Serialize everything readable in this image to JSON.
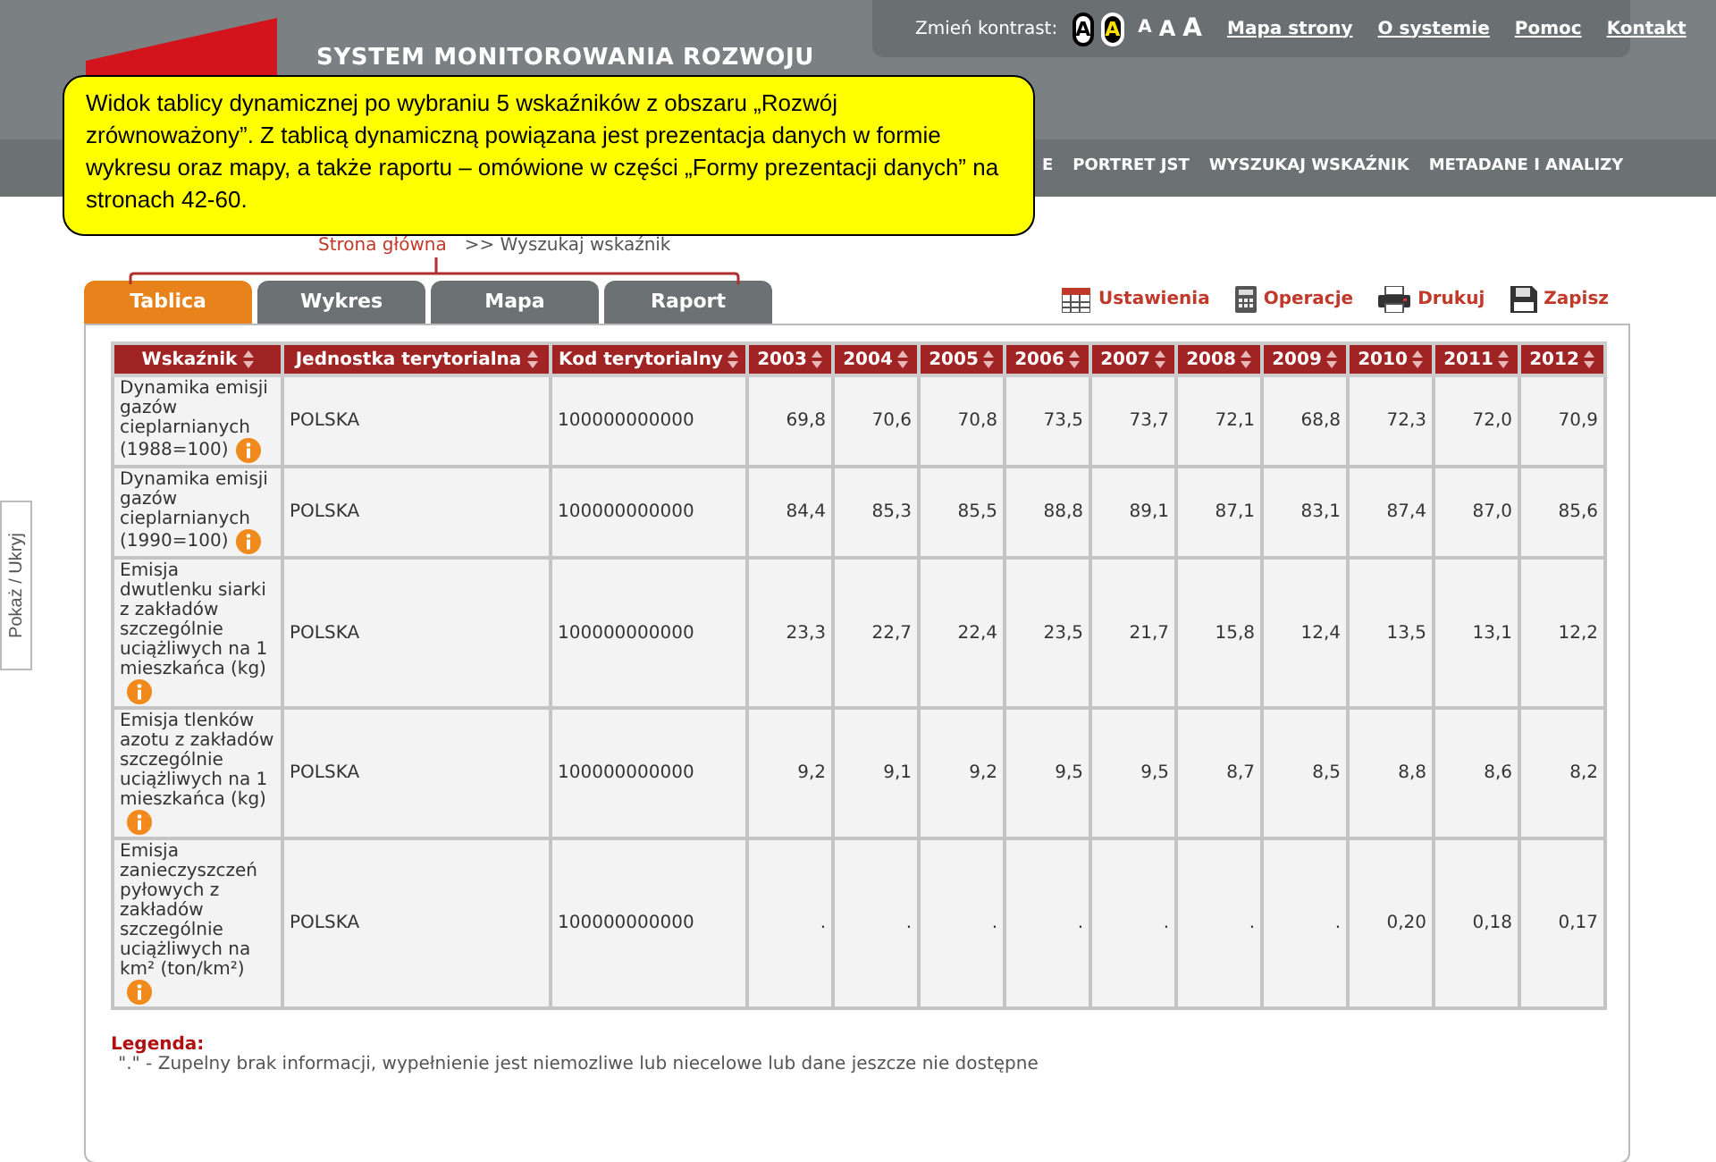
{
  "header": {
    "title": "SYSTEM MONITOROWANIA ROZWOJU",
    "contrast_label": "Zmień kontrast:",
    "contrast_buttons": [
      {
        "label": "A",
        "kind": "normal"
      },
      {
        "label": "A",
        "kind": "high"
      }
    ],
    "font_sizes": [
      "A",
      "A",
      "A"
    ],
    "links": [
      "Mapa strony",
      "O systemie",
      "Pomoc",
      "Kontakt"
    ]
  },
  "nav": {
    "items": [
      "E",
      "PORTRET JST",
      "WYSZUKAJ WSKAŹNIK",
      "METADANE I ANALIZY"
    ]
  },
  "breadcrumb": [
    "Strona główna",
    ">> Wyszukaj wskaźnik"
  ],
  "callout": "Widok tablicy dynamicznej po wybraniu 5 wskaźników z obszaru „Rozwój zrównoważony”.  Z tablicą dynamiczną powiązana jest prezentacja danych w formie wykresu oraz mapy, a także raportu – omówione w części  „Formy prezentacji danych” na stronach 42-60.",
  "side_toggle": "Pokaż / Ukryj",
  "tabs": [
    {
      "label": "Tablica",
      "selected": true
    },
    {
      "label": "Wykres",
      "selected": false
    },
    {
      "label": "Mapa",
      "selected": false
    },
    {
      "label": "Raport",
      "selected": false
    }
  ],
  "actions": [
    {
      "label": "Ustawienia",
      "kind": "settings"
    },
    {
      "label": "Operacje",
      "kind": "calculator"
    },
    {
      "label": "Drukuj",
      "kind": "print"
    },
    {
      "label": "Zapisz",
      "kind": "save"
    }
  ],
  "table": {
    "columns": [
      "Wskaźnik",
      "Jednostka terytorialna",
      "Kod terytorialny",
      "2003",
      "2004",
      "2005",
      "2006",
      "2007",
      "2008",
      "2009",
      "2010",
      "2011",
      "2012"
    ],
    "rows": [
      {
        "indicator": "Dynamika emisji gazów cieplarnianych (1988=100)",
        "unit": "POLSKA",
        "code": "100000000000",
        "values": [
          "69,8",
          "70,6",
          "70,8",
          "73,5",
          "73,7",
          "72,1",
          "68,8",
          "72,3",
          "72,0",
          "70,9"
        ]
      },
      {
        "indicator": "Dynamika emisji gazów cieplarnianych (1990=100)",
        "unit": "POLSKA",
        "code": "100000000000",
        "values": [
          "84,4",
          "85,3",
          "85,5",
          "88,8",
          "89,1",
          "87,1",
          "83,1",
          "87,4",
          "87,0",
          "85,6"
        ]
      },
      {
        "indicator": "Emisja dwutlenku siarki z zakładów szczególnie uciążliwych na 1 mieszkańca (kg)",
        "unit": "POLSKA",
        "code": "100000000000",
        "values": [
          "23,3",
          "22,7",
          "22,4",
          "23,5",
          "21,7",
          "15,8",
          "12,4",
          "13,5",
          "13,1",
          "12,2"
        ]
      },
      {
        "indicator": "Emisja tlenków azotu z zakładów szczególnie uciążliwych na 1 mieszkańca (kg)",
        "unit": "POLSKA",
        "code": "100000000000",
        "values": [
          "9,2",
          "9,1",
          "9,2",
          "9,5",
          "9,5",
          "8,7",
          "8,5",
          "8,8",
          "8,6",
          "8,2"
        ]
      },
      {
        "indicator": "Emisja zanieczyszczeń pyłowych z zakładów szczególnie uciążliwych na km² (ton/km²)",
        "unit": "POLSKA",
        "code": "100000000000",
        "values": [
          ".",
          ".",
          ".",
          ".",
          ".",
          ".",
          ".",
          "0,20",
          "0,18",
          "0,17"
        ]
      }
    ]
  },
  "legend": {
    "title": "Legenda:",
    "text": "\".\" - Zupelny brak informacji, wypełnienie jest niemozliwe lub niecelowe lub dane jeszcze nie dostępne"
  }
}
